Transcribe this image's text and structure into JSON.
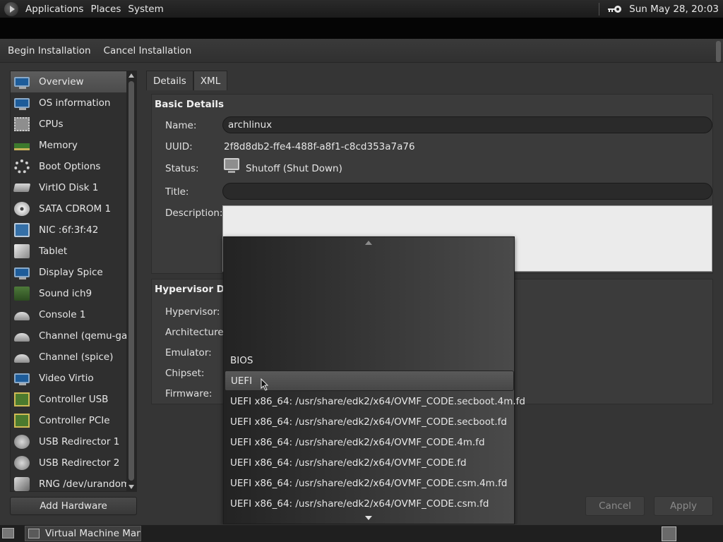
{
  "top_panel": {
    "menus": [
      "Applications",
      "Places",
      "System"
    ],
    "clock": "Sun May 28, 20:03"
  },
  "toolbar": {
    "begin_label": "Begin Installation",
    "cancel_label": "Cancel Installation"
  },
  "sidebar": {
    "items": [
      {
        "label": "Overview",
        "icon": "monitor-icon"
      },
      {
        "label": "OS information",
        "icon": "monitor-icon"
      },
      {
        "label": "CPUs",
        "icon": "cpu-icon"
      },
      {
        "label": "Memory",
        "icon": "memory-icon"
      },
      {
        "label": "Boot Options",
        "icon": "gears-icon"
      },
      {
        "label": "VirtIO Disk 1",
        "icon": "disk-icon"
      },
      {
        "label": "SATA CDROM 1",
        "icon": "cdrom-icon"
      },
      {
        "label": "NIC :6f:3f:42",
        "icon": "network-icon"
      },
      {
        "label": "Tablet",
        "icon": "tablet-icon"
      },
      {
        "label": "Display Spice",
        "icon": "monitor-icon"
      },
      {
        "label": "Sound ich9",
        "icon": "sound-icon"
      },
      {
        "label": "Console 1",
        "icon": "serial-icon"
      },
      {
        "label": "Channel (qemu-ga)",
        "icon": "serial-icon"
      },
      {
        "label": "Channel (spice)",
        "icon": "serial-icon"
      },
      {
        "label": "Video Virtio",
        "icon": "monitor-icon"
      },
      {
        "label": "Controller USB",
        "icon": "controller-icon"
      },
      {
        "label": "Controller PCIe",
        "icon": "controller-icon"
      },
      {
        "label": "USB Redirector 1",
        "icon": "usb-icon"
      },
      {
        "label": "USB Redirector 2",
        "icon": "usb-icon"
      },
      {
        "label": "RNG /dev/urandom",
        "icon": "rng-icon"
      }
    ],
    "selected": "Overview",
    "add_hardware_label": "Add Hardware"
  },
  "tabs": [
    "Details",
    "XML"
  ],
  "basic_details": {
    "title": "Basic Details",
    "name_label": "Name:",
    "name_value": "archlinux",
    "uuid_label": "UUID:",
    "uuid_value": "2f8d8db2-ffe4-488f-a8f1-c8cd353a7a76",
    "status_label": "Status:",
    "status_value": "Shutoff (Shut Down)",
    "title_label": "Title:",
    "title_value": "",
    "description_label": "Description:"
  },
  "hypervisor_details": {
    "title": "Hypervisor Deta",
    "hypervisor_label": "Hypervisor:",
    "architecture_label": "Architecture:",
    "emulator_label": "Emulator:",
    "chipset_label": "Chipset:",
    "firmware_label": "Firmware:"
  },
  "firmware_popup": {
    "options": [
      "BIOS",
      "UEFI",
      "UEFI x86_64: /usr/share/edk2/x64/OVMF_CODE.secboot.4m.fd",
      "UEFI x86_64: /usr/share/edk2/x64/OVMF_CODE.secboot.fd",
      "UEFI x86_64: /usr/share/edk2/x64/OVMF_CODE.4m.fd",
      "UEFI x86_64: /usr/share/edk2/x64/OVMF_CODE.fd",
      "UEFI x86_64: /usr/share/edk2/x64/OVMF_CODE.csm.4m.fd",
      "UEFI x86_64: /usr/share/edk2/x64/OVMF_CODE.csm.fd"
    ],
    "hovered": "UEFI"
  },
  "buttons": {
    "cancel_label": "Cancel",
    "apply_label": "Apply"
  },
  "taskbar": {
    "window_label": "Virtual Machine Man..."
  }
}
